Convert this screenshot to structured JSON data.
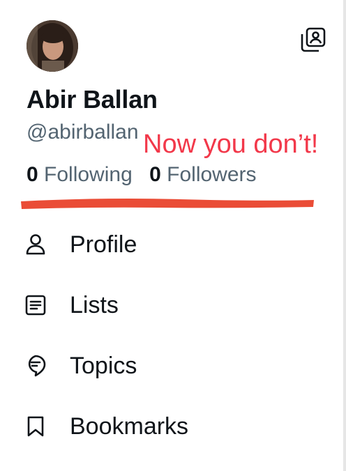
{
  "profile": {
    "display_name": "Abir Ballan",
    "handle": "@abirballan",
    "following_count": "0",
    "following_label": "Following",
    "followers_count": "0",
    "followers_label": "Followers"
  },
  "annotation": {
    "text": "Now you don’t!",
    "color": "#f2384a"
  },
  "redaction_color": "#ea4c36",
  "icons": {
    "account_switch": "account-switch-icon",
    "profile": "person-icon",
    "lists": "list-icon",
    "topics": "topics-icon",
    "bookmarks": "bookmark-icon"
  },
  "nav": {
    "items": [
      {
        "label": "Profile"
      },
      {
        "label": "Lists"
      },
      {
        "label": "Topics"
      },
      {
        "label": "Bookmarks"
      }
    ]
  }
}
